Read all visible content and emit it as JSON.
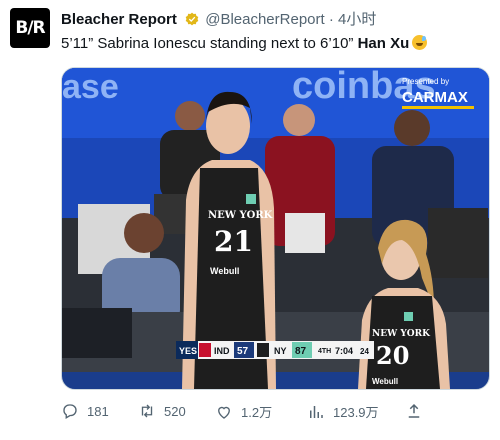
{
  "tweet": {
    "avatar_text": "B/R",
    "author_name": "Bleacher Report",
    "handle": "@BleacherReport",
    "separator": "·",
    "time": "4小时",
    "text_before": "5’11” Sabrina Ionescu standing next to 6’10” ",
    "text_bold": "Han Xu"
  },
  "media": {
    "banner_left": "ase",
    "banner_right": "coinbas",
    "sponsor_small": "Presented by",
    "sponsor_big": "CARMAX",
    "player_left_team": "NEW YORK",
    "player_left_number": "21",
    "player_left_brand": "Webull",
    "player_right_team": "NEW YORK",
    "player_right_number": "20",
    "player_right_brand": "Webull",
    "scorebug": {
      "network": "YES",
      "away_team": "IND",
      "away_score": "57",
      "home_team": "NY",
      "home_score": "87",
      "quarter": "4TH",
      "clock": "7:04",
      "shot_clock": "24"
    }
  },
  "actions": {
    "replies": "181",
    "retweets": "520",
    "likes": "1.2万",
    "views": "123.9万"
  },
  "colors": {
    "court_blue": "#1a3d8c",
    "jersey": "#1e1e1e",
    "mint": "#6ecdb2",
    "verified_gold": "#e2b719"
  }
}
